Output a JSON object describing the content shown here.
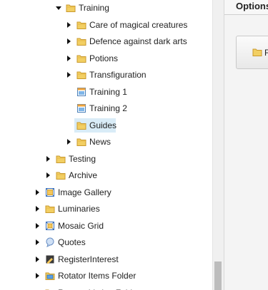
{
  "tree": {
    "nodes": [
      {
        "label": "Training",
        "icon": "folder-icon",
        "expander": "down",
        "level": 3
      },
      {
        "label": "Care of magical creatures",
        "icon": "folder-icon",
        "expander": "right",
        "level": 4
      },
      {
        "label": "Defence against dark arts",
        "icon": "folder-icon",
        "expander": "right",
        "level": 4
      },
      {
        "label": "Potions",
        "icon": "folder-icon",
        "expander": "right",
        "level": 4
      },
      {
        "label": "Transfiguration",
        "icon": "folder-icon",
        "expander": "right",
        "level": 4
      },
      {
        "label": "Training 1",
        "icon": "page-icon",
        "expander": "none",
        "level": 4
      },
      {
        "label": "Training 2",
        "icon": "page-icon",
        "expander": "none",
        "level": 4
      },
      {
        "label": "Guides",
        "icon": "folder-icon",
        "expander": "none",
        "level": 4,
        "selected": true
      },
      {
        "label": "News",
        "icon": "folder-icon",
        "expander": "right",
        "level": 4
      },
      {
        "label": "Testing",
        "icon": "folder-icon",
        "expander": "right",
        "level": 2
      },
      {
        "label": "Archive",
        "icon": "folder-icon",
        "expander": "right",
        "level": 2
      },
      {
        "label": "Image Gallery",
        "icon": "gallery-icon",
        "expander": "right",
        "level": 1
      },
      {
        "label": "Luminaries",
        "icon": "folder-icon",
        "expander": "right",
        "level": 1
      },
      {
        "label": "Mosaic Grid",
        "icon": "grid-icon",
        "expander": "right",
        "level": 1
      },
      {
        "label": "Quotes",
        "icon": "quote-icon",
        "expander": "right",
        "level": 1
      },
      {
        "label": "RegisterInterest",
        "icon": "form-icon",
        "expander": "right",
        "level": 1
      },
      {
        "label": "Rotator Items Folder",
        "icon": "folder-items-icon",
        "expander": "right",
        "level": 1
      },
      {
        "label": "Rotator Listing Folder",
        "icon": "folder-icon",
        "expander": "right",
        "level": 1
      }
    ]
  },
  "options": {
    "title": "Options",
    "button_label": "F",
    "button_icon": "folder-icon"
  },
  "colors": {
    "selected_bg": "#d9ecf7",
    "folder": "#f2cf63",
    "folder_dark": "#c99a2e"
  }
}
